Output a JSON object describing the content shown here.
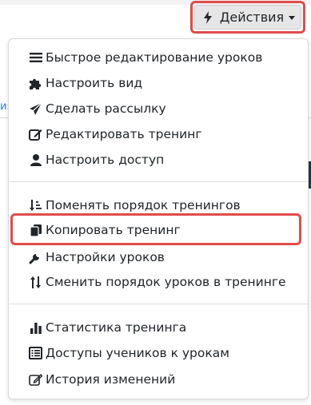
{
  "toolbar": {
    "actions_label": "Действия"
  },
  "menu": {
    "group1": [
      {
        "label": "Быстрое редактирование уроков",
        "icon": "list-icon"
      },
      {
        "label": "Настроить вид",
        "icon": "puzzle-icon"
      },
      {
        "label": "Сделать рассылку",
        "icon": "send-icon"
      },
      {
        "label": "Редактировать тренинг",
        "icon": "edit-icon"
      },
      {
        "label": "Настроить доступ",
        "icon": "user-icon"
      }
    ],
    "group2": [
      {
        "label": "Поменять порядок тренингов",
        "icon": "sort-icon"
      },
      {
        "label": "Копировать тренинг",
        "icon": "copy-icon"
      },
      {
        "label": "Настройки уроков",
        "icon": "wrench-icon"
      },
      {
        "label": "Сменить порядок уроков в тренинге",
        "icon": "swap-vertical-icon"
      }
    ],
    "group3": [
      {
        "label": "Статистика тренинга",
        "icon": "bar-chart-icon"
      },
      {
        "label": "Доступы учеников к урокам",
        "icon": "table-list-icon"
      },
      {
        "label": "История изменений",
        "icon": "edit-icon"
      }
    ]
  },
  "background": {
    "fragment_text": "ия"
  },
  "colors": {
    "highlight": "#e14b4b",
    "button_bg": "#e6e6e6",
    "link": "#3a7bd5"
  }
}
